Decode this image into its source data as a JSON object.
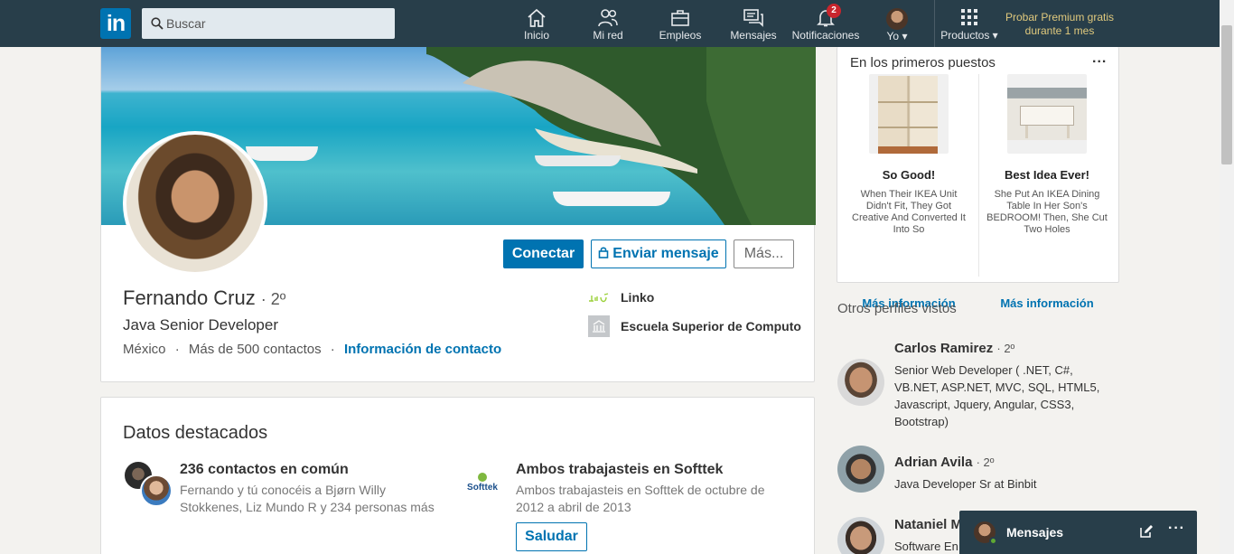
{
  "nav": {
    "logo": "in",
    "search_placeholder": "Buscar",
    "items": [
      {
        "label": "Inicio"
      },
      {
        "label": "Mi red"
      },
      {
        "label": "Empleos"
      },
      {
        "label": "Mensajes"
      },
      {
        "label": "Notificaciones",
        "badge": "2"
      },
      {
        "label": "Yo"
      },
      {
        "label": "Productos"
      }
    ],
    "premium_line1": "Probar Premium gratis",
    "premium_line2": "durante 1 mes"
  },
  "profile": {
    "name": "Fernando Cruz",
    "degree": "· 2º",
    "headline": "Java Senior Developer",
    "location": "México",
    "sep1": "·",
    "contacts": "Más de 500 contactos",
    "sep2": "·",
    "contact_info_link": "Información de contacto",
    "buttons": {
      "connect": "Conectar",
      "message": "Enviar mensaje",
      "more": "Más..."
    },
    "company": "Linko",
    "school": "Escuela Superior de Computo"
  },
  "highlights": {
    "title": "Datos destacados",
    "mutual": {
      "heading": "236 contactos en común",
      "line1": "Fernando y tú conocéis a Bjørn Willy",
      "line2": "Stokkenes, Liz Mundo R y 234 personas más"
    },
    "work": {
      "heading": "Ambos trabajasteis en Softtek",
      "line1": "Ambos trabajasteis en Softtek de octubre de",
      "line2": "2012 a abril de 2013",
      "logo_text": "Softtek",
      "button": "Saludar"
    }
  },
  "ads": {
    "title": "En los primeros puestos",
    "menu": "...",
    "items": [
      {
        "heading": "So Good!",
        "desc": "When Their IKEA Unit Didn't Fit, They Got Creative And Converted It Into So",
        "link": "Más información"
      },
      {
        "heading": "Best Idea Ever!",
        "desc": "She Put An IKEA Dining Table In Her Son's BEDROOM! Then, She Cut Two Holes",
        "link": "Más información"
      }
    ]
  },
  "others": {
    "title": "Otros perfiles vistos",
    "people": [
      {
        "name": "Carlos Ramirez",
        "degree": "· 2º",
        "headline": "Senior Web Developer ( .NET, C#, VB.NET, ASP.NET, MVC, SQL, HTML5, Javascript, Jquery, Angular, CSS3, Bootstrap)"
      },
      {
        "name": "Adrian Avila",
        "degree": "· 2º",
        "headline": "Java Developer Sr at Binbit"
      },
      {
        "name": "Nataniel M",
        "degree": "",
        "headline": "Software En"
      }
    ]
  },
  "messaging": {
    "label": "Mensajes",
    "more": "···"
  }
}
